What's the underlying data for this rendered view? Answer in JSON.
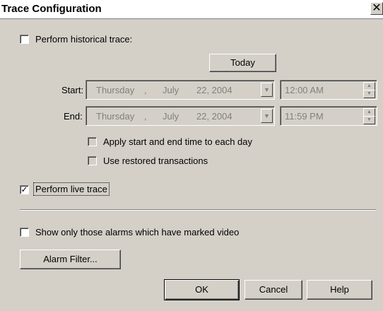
{
  "window": {
    "title": "Trace Configuration",
    "close_glyph": "✕"
  },
  "historical": {
    "checkbox": {
      "checked": false,
      "label": "Perform historical trace:"
    },
    "today_button": "Today",
    "start": {
      "label": "Start:",
      "weekday": "Thursday",
      "sep": ",",
      "month": "July",
      "date_year": "22, 2004",
      "time": "12:00 AM"
    },
    "end": {
      "label": "End:",
      "weekday": "Thursday",
      "sep": ",",
      "month": "July",
      "date_year": "22, 2004",
      "time": "11:59 PM"
    },
    "apply_each_day": {
      "checked": false,
      "label": "Apply start and end time to each day"
    },
    "use_restored": {
      "checked": false,
      "label": "Use restored transactions"
    }
  },
  "live_trace": {
    "checked": true,
    "label": "Perform live trace"
  },
  "marked_video": {
    "checked": false,
    "label": "Show only those alarms which have marked video"
  },
  "buttons": {
    "alarm_filter": "Alarm Filter...",
    "ok": "OK",
    "cancel": "Cancel",
    "help": "Help"
  }
}
